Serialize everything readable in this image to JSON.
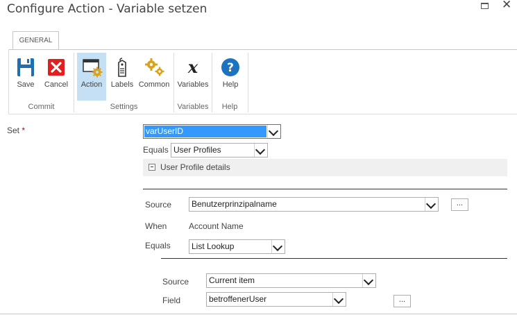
{
  "window": {
    "title": "Configure Action - Variable setzen",
    "maximize_icon": "maximize-icon",
    "close_glyph": "✕"
  },
  "ribbon": {
    "tab_label": "GENERAL",
    "buttons": {
      "save": "Save",
      "cancel": "Cancel",
      "action": "Action",
      "labels": "Labels",
      "common": "Common",
      "variables": "Variables",
      "help": "Help"
    },
    "groups": {
      "commit": "Commit",
      "settings": "Settings",
      "variables": "Variables",
      "help": "Help"
    },
    "colors": {
      "save_icon": "#1f6fb5",
      "cancel_icon": "#e02020",
      "help_icon": "#1e73be",
      "gear_icon": "#d8a21c",
      "selected_bg": "#c5dff5"
    }
  },
  "form": {
    "set_label": "Set",
    "required_mark": "*",
    "set_value": "varUserID",
    "equals_label": "Equals",
    "equals_value": "User Profiles",
    "section_title": "User Profile details",
    "source_label": "Source",
    "source_value": "Benutzerprinzipalname",
    "dots": "...",
    "when_label": "When",
    "when_value": "Account Name",
    "equals2_label": "Equals",
    "equals2_value": "List Lookup",
    "lookup_source_label": "Source",
    "lookup_source_value": "Current item",
    "field_label": "Field",
    "field_value": "betroffenerUser",
    "dots2": "..."
  }
}
